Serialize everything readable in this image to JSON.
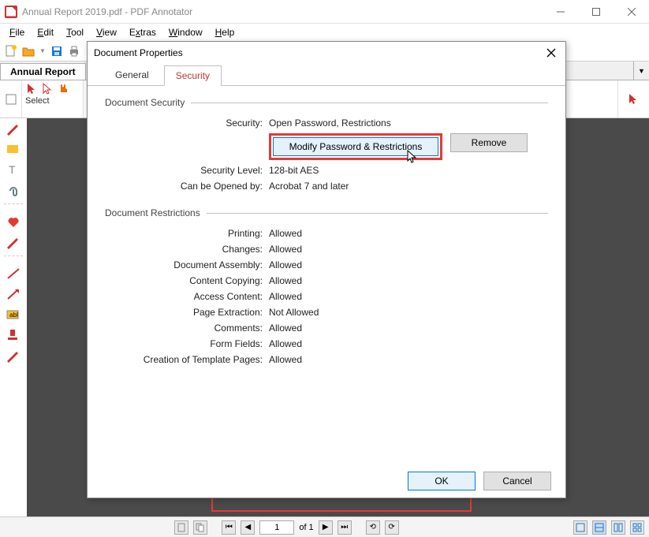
{
  "window": {
    "title": "Annual Report 2019.pdf - PDF Annotator"
  },
  "menu": {
    "file": "File",
    "edit": "Edit",
    "tool": "Tool",
    "view": "View",
    "extras": "Extras",
    "window": "Window",
    "help": "Help"
  },
  "doctab": {
    "label": "Annual Report"
  },
  "ribbon": {
    "select_label": "Select"
  },
  "dialog": {
    "title": "Document Properties",
    "tabs": {
      "general": "General",
      "security": "Security"
    },
    "security_section": "Document Security",
    "rows": {
      "security_k": "Security:",
      "security_v": "Open Password, Restrictions",
      "modify_btn": "Modify Password & Restrictions",
      "remove_btn": "Remove",
      "level_k": "Security Level:",
      "level_v": "128-bit AES",
      "opened_k": "Can be Opened by:",
      "opened_v": "Acrobat 7 and later"
    },
    "restrictions_section": "Document Restrictions",
    "restrictions": {
      "printing_k": "Printing:",
      "printing_v": "Allowed",
      "changes_k": "Changes:",
      "changes_v": "Allowed",
      "assembly_k": "Document Assembly:",
      "assembly_v": "Allowed",
      "copying_k": "Content Copying:",
      "copying_v": "Allowed",
      "access_k": "Access Content:",
      "access_v": "Allowed",
      "extraction_k": "Page Extraction:",
      "extraction_v": "Not Allowed",
      "comments_k": "Comments:",
      "comments_v": "Allowed",
      "forms_k": "Form Fields:",
      "forms_v": "Allowed",
      "template_k": "Creation of Template Pages:",
      "template_v": "Allowed"
    },
    "ok": "OK",
    "cancel": "Cancel"
  },
  "nav": {
    "page_value": "1",
    "page_total": "of 1"
  }
}
